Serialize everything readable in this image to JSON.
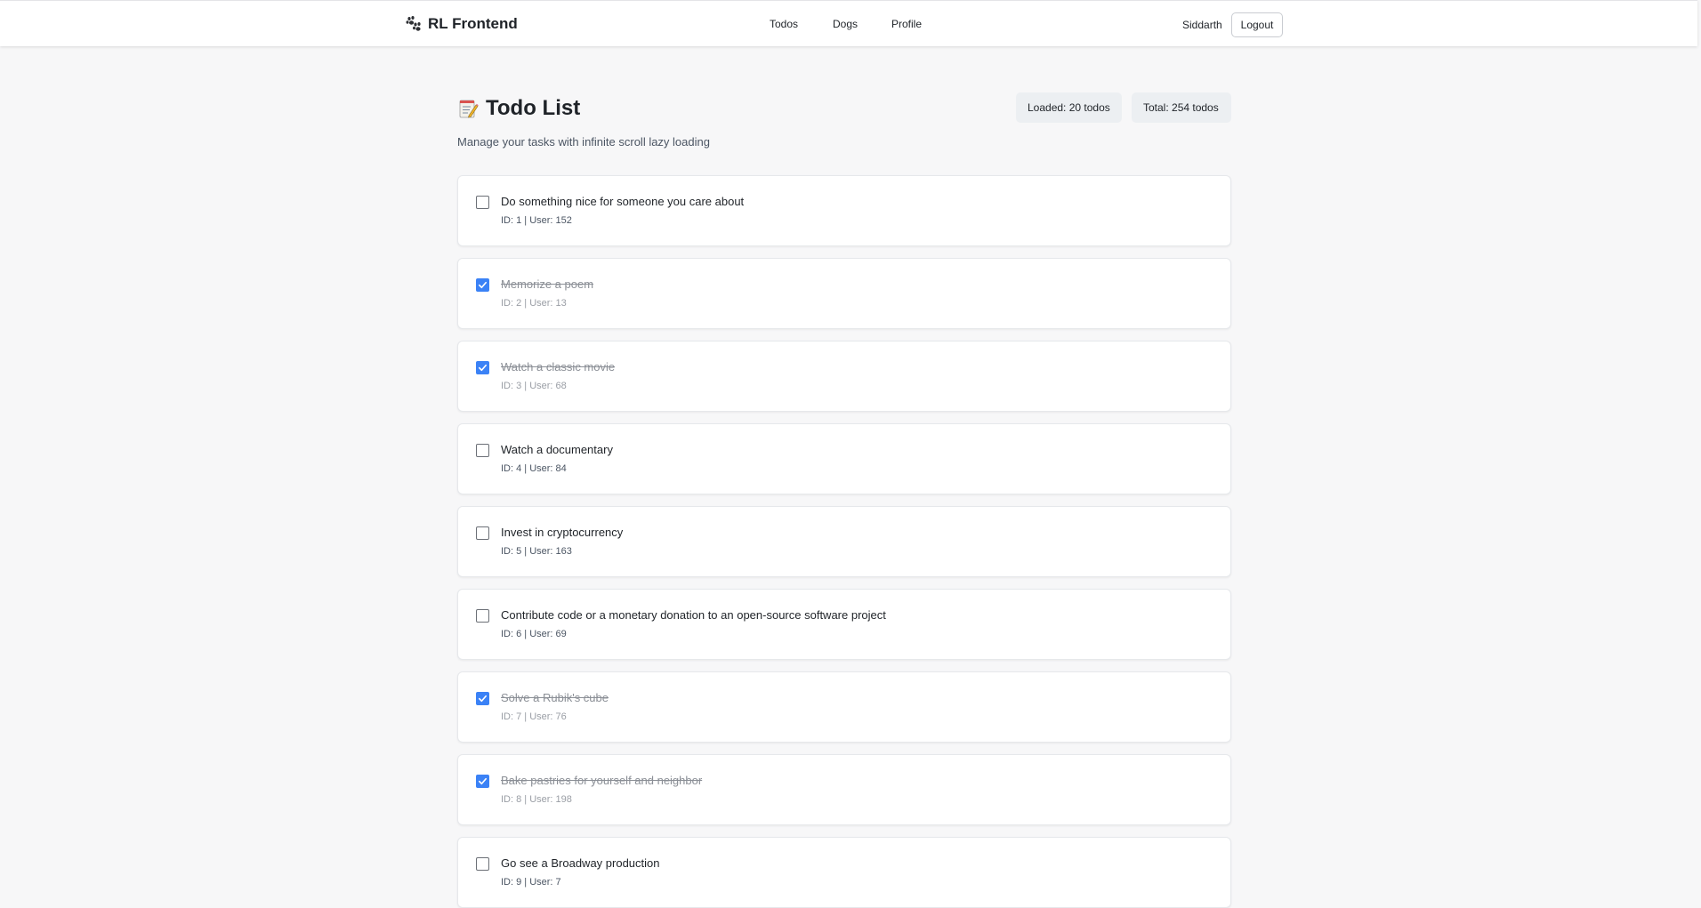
{
  "nav": {
    "brand": "RL Frontend",
    "brand_icon": "paw-prints-icon",
    "links": [
      "Todos",
      "Dogs",
      "Profile"
    ],
    "user": "Siddarth",
    "logout": "Logout"
  },
  "header": {
    "title": "Todo List",
    "title_icon": "memo-icon",
    "subtitle": "Manage your tasks with infinite scroll lazy loading",
    "loaded": "Loaded: 20 todos",
    "total": "Total: 254 todos"
  },
  "colors": {
    "checkbox_checked": "#3b82f6",
    "text": "#1f2328",
    "muted": "#8b8f96"
  },
  "todos": [
    {
      "title": "Do something nice for someone you care about",
      "meta": "ID: 1 | User: 152",
      "completed": false
    },
    {
      "title": "Memorize a poem",
      "meta": "ID: 2 | User: 13",
      "completed": true
    },
    {
      "title": "Watch a classic movie",
      "meta": "ID: 3 | User: 68",
      "completed": true
    },
    {
      "title": "Watch a documentary",
      "meta": "ID: 4 | User: 84",
      "completed": false
    },
    {
      "title": "Invest in cryptocurrency",
      "meta": "ID: 5 | User: 163",
      "completed": false
    },
    {
      "title": "Contribute code or a monetary donation to an open-source software project",
      "meta": "ID: 6 | User: 69",
      "completed": false
    },
    {
      "title": "Solve a Rubik's cube",
      "meta": "ID: 7 | User: 76",
      "completed": true
    },
    {
      "title": "Bake pastries for yourself and neighbor",
      "meta": "ID: 8 | User: 198",
      "completed": true
    },
    {
      "title": "Go see a Broadway production",
      "meta": "ID: 9 | User: 7",
      "completed": false
    }
  ]
}
